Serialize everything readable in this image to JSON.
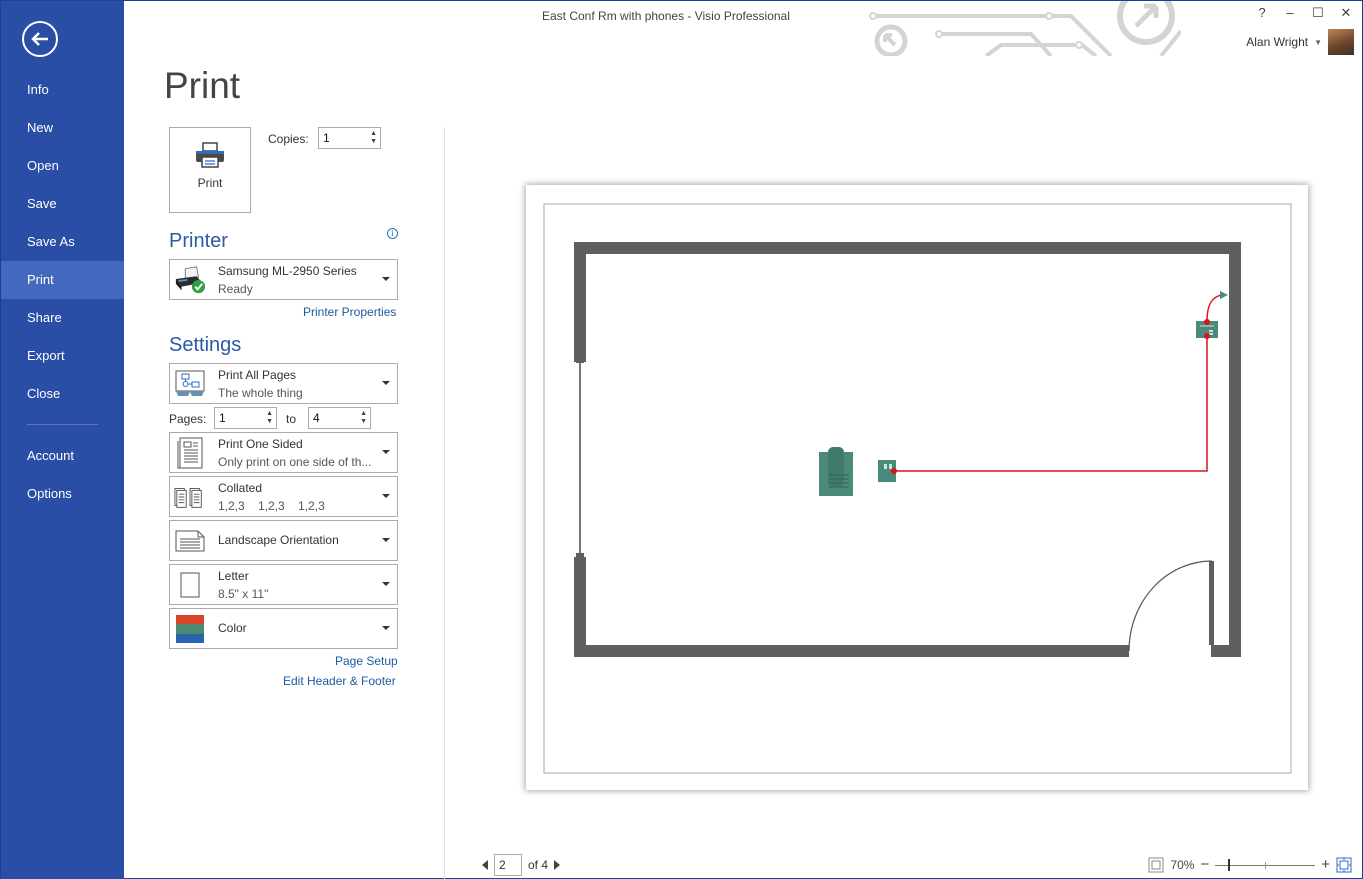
{
  "window": {
    "title": "East Conf Rm with phones - Visio Professional",
    "controls": {
      "help": "?",
      "minimize": "–",
      "restore": "☐",
      "close": "✕"
    },
    "user_name": "Alan Wright"
  },
  "sidebar": {
    "back_icon": "back-arrow-icon",
    "items": [
      {
        "label": "Info",
        "active": false
      },
      {
        "label": "New",
        "active": false
      },
      {
        "label": "Open",
        "active": false
      },
      {
        "label": "Save",
        "active": false
      },
      {
        "label": "Save As",
        "active": false
      },
      {
        "label": "Print",
        "active": true
      },
      {
        "label": "Share",
        "active": false
      },
      {
        "label": "Export",
        "active": false
      },
      {
        "label": "Close",
        "active": false
      }
    ],
    "bottom_items": [
      {
        "label": "Account"
      },
      {
        "label": "Options"
      }
    ]
  },
  "print": {
    "page_title": "Print",
    "print_button_label": "Print",
    "copies_label": "Copies:",
    "copies_value": "1",
    "printer_heading": "Printer",
    "printer": {
      "name": "Samsung ML-2950 Series",
      "status": "Ready"
    },
    "printer_properties_link": "Printer Properties",
    "settings_heading": "Settings",
    "settings": {
      "range": {
        "title": "Print All Pages",
        "subtitle": "The whole thing"
      },
      "pages_label": "Pages:",
      "pages_from": "1",
      "pages_to_label": "to",
      "pages_to": "4",
      "sides": {
        "title": "Print One Sided",
        "subtitle": "Only print on one side of th..."
      },
      "collation": {
        "title": "Collated",
        "subtitle": "1,2,3    1,2,3    1,2,3"
      },
      "orientation": {
        "title": "Landscape Orientation"
      },
      "paper": {
        "title": "Letter",
        "subtitle": "8.5\" x 11\""
      },
      "color": {
        "title": "Color"
      }
    },
    "page_setup_link": "Page Setup",
    "header_footer_link": "Edit Header & Footer"
  },
  "preview": {
    "current_page": "2",
    "of_label": "of 4",
    "zoom_level": "70%",
    "zoom_fraction": 0.13,
    "colors": {
      "wall": "#5f5f5f",
      "equipment": "#4a8a7a",
      "connector": "#d9141a"
    }
  },
  "theme": {
    "accent": "#2a4ea6",
    "accent_active": "#4468bd",
    "link": "#1e5aa0",
    "heading": "#2a5aa8"
  }
}
